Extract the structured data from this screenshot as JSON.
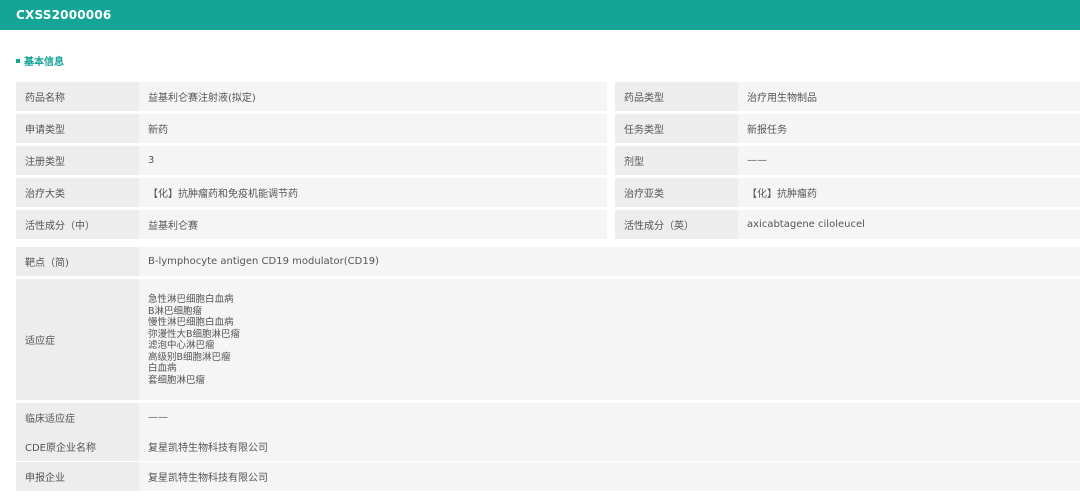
{
  "header": {
    "title": "CXSS2000006"
  },
  "section": {
    "title": "基本信息"
  },
  "basic_rows": [
    {
      "l1": "药品名称",
      "v1": "益基利仑赛注射液(拟定)",
      "l2": "药品类型",
      "v2": "治疗用生物制品"
    },
    {
      "l1": "申请类型",
      "v1": "新药",
      "l2": "任务类型",
      "v2": "新报任务"
    },
    {
      "l1": "注册类型",
      "v1": "3",
      "l2": "剂型",
      "v2": "——"
    },
    {
      "l1": "治疗大类",
      "v1": "【化】抗肿瘤药和免疫机能调节药",
      "l2": "治疗亚类",
      "v2": "【化】抗肿瘤药"
    },
    {
      "l1": "活性成分（中）",
      "v1": "益基利仑赛",
      "l2": "活性成分（英）",
      "v2": "axicabtagene ciloleucel"
    }
  ],
  "detail": {
    "target": {
      "label": "靶点（简)",
      "value": "B-lymphocyte antigen CD19 modulator(CD19)"
    },
    "indication": {
      "label": "适应症",
      "values": [
        "急性淋巴细胞白血病",
        "B淋巴细胞瘤",
        "慢性淋巴细胞白血病",
        "弥漫性大B细胞淋巴瘤",
        "滤泡中心淋巴瘤",
        "高级别B细胞淋巴瘤",
        "白血病",
        "套细胞淋巴瘤"
      ]
    },
    "clinical": {
      "label": "临床适应症",
      "value": "——"
    },
    "cde_company": {
      "label": "CDE原企业名称",
      "value": "复星凯特生物科技有限公司"
    },
    "applicant": {
      "label": "申报企业",
      "value": "复星凯特生物科技有限公司"
    }
  }
}
